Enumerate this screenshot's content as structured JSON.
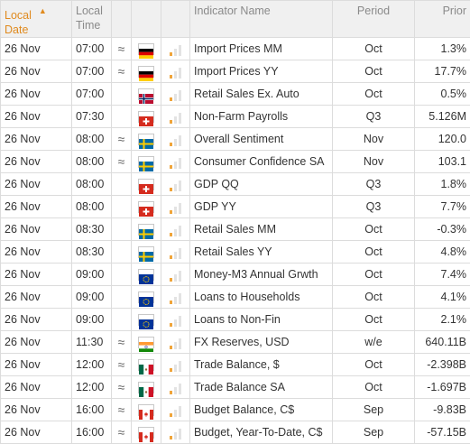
{
  "header": {
    "date_line1": "Local",
    "date_line2": "Date",
    "time_line1": "Local",
    "time_line2": "Time",
    "indicator": "Indicator Name",
    "period": "Period",
    "prior": "Prior",
    "sort_icon": "sort-asc-triangle"
  },
  "colors": {
    "accent": "#e08a1e",
    "importance_on": "#f0a53a",
    "importance_off": "#e3e3e3"
  },
  "rows": [
    {
      "date": "26 Nov",
      "time": "07:00",
      "volatile": "≈",
      "flag": "germany",
      "importance": 1,
      "indicator": "Import Prices MM",
      "period": "Oct",
      "prior": "1.3%"
    },
    {
      "date": "26 Nov",
      "time": "07:00",
      "volatile": "≈",
      "flag": "germany",
      "importance": 1,
      "indicator": "Import Prices YY",
      "period": "Oct",
      "prior": "17.7%"
    },
    {
      "date": "26 Nov",
      "time": "07:00",
      "volatile": "",
      "flag": "norway",
      "importance": 1,
      "indicator": "Retail Sales Ex. Auto",
      "period": "Oct",
      "prior": "0.5%"
    },
    {
      "date": "26 Nov",
      "time": "07:30",
      "volatile": "",
      "flag": "switzerland",
      "importance": 1,
      "indicator": "Non-Farm Payrolls",
      "period": "Q3",
      "prior": "5.126M"
    },
    {
      "date": "26 Nov",
      "time": "08:00",
      "volatile": "≈",
      "flag": "sweden",
      "importance": 1,
      "indicator": "Overall Sentiment",
      "period": "Nov",
      "prior": "120.0"
    },
    {
      "date": "26 Nov",
      "time": "08:00",
      "volatile": "≈",
      "flag": "sweden",
      "importance": 1,
      "indicator": "Consumer Confidence SA",
      "period": "Nov",
      "prior": "103.1"
    },
    {
      "date": "26 Nov",
      "time": "08:00",
      "volatile": "",
      "flag": "switzerland",
      "importance": 1,
      "indicator": "GDP QQ",
      "period": "Q3",
      "prior": "1.8%"
    },
    {
      "date": "26 Nov",
      "time": "08:00",
      "volatile": "",
      "flag": "switzerland",
      "importance": 1,
      "indicator": "GDP YY",
      "period": "Q3",
      "prior": "7.7%"
    },
    {
      "date": "26 Nov",
      "time": "08:30",
      "volatile": "",
      "flag": "sweden",
      "importance": 1,
      "indicator": "Retail Sales MM",
      "period": "Oct",
      "prior": "-0.3%"
    },
    {
      "date": "26 Nov",
      "time": "08:30",
      "volatile": "",
      "flag": "sweden",
      "importance": 1,
      "indicator": "Retail Sales YY",
      "period": "Oct",
      "prior": "4.8%"
    },
    {
      "date": "26 Nov",
      "time": "09:00",
      "volatile": "",
      "flag": "eu",
      "importance": 1,
      "indicator": "Money-M3 Annual Grwth",
      "period": "Oct",
      "prior": "7.4%"
    },
    {
      "date": "26 Nov",
      "time": "09:00",
      "volatile": "",
      "flag": "eu",
      "importance": 1,
      "indicator": "Loans to Households",
      "period": "Oct",
      "prior": "4.1%"
    },
    {
      "date": "26 Nov",
      "time": "09:00",
      "volatile": "",
      "flag": "eu",
      "importance": 1,
      "indicator": "Loans to Non-Fin",
      "period": "Oct",
      "prior": "2.1%"
    },
    {
      "date": "26 Nov",
      "time": "11:30",
      "volatile": "≈",
      "flag": "india",
      "importance": 1,
      "indicator": "FX Reserves, USD",
      "period": "w/e",
      "prior": "640.11B"
    },
    {
      "date": "26 Nov",
      "time": "12:00",
      "volatile": "≈",
      "flag": "mexico",
      "importance": 1,
      "indicator": "Trade Balance, $",
      "period": "Oct",
      "prior": "-2.398B"
    },
    {
      "date": "26 Nov",
      "time": "12:00",
      "volatile": "≈",
      "flag": "mexico",
      "importance": 1,
      "indicator": "Trade Balance SA",
      "period": "Oct",
      "prior": "-1.697B"
    },
    {
      "date": "26 Nov",
      "time": "16:00",
      "volatile": "≈",
      "flag": "canada",
      "importance": 1,
      "indicator": "Budget Balance, C$",
      "period": "Sep",
      "prior": "-9.83B"
    },
    {
      "date": "26 Nov",
      "time": "16:00",
      "volatile": "≈",
      "flag": "canada",
      "importance": 1,
      "indicator": "Budget, Year-To-Date, C$",
      "period": "Sep",
      "prior": "-57.15B"
    }
  ]
}
